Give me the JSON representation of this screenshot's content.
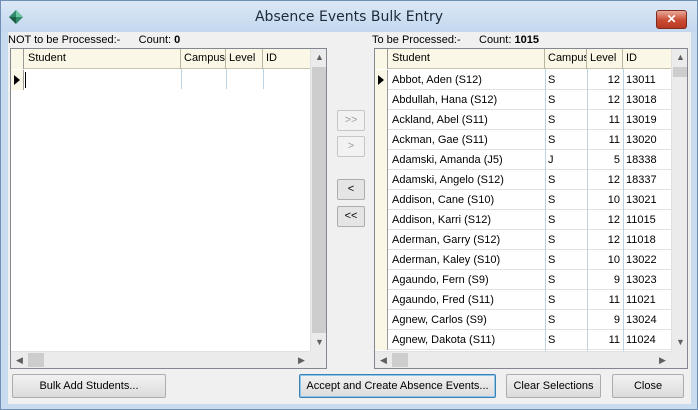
{
  "window": {
    "title": "Absence Events Bulk Entry",
    "close_glyph": "✕"
  },
  "left": {
    "caption_label": "NOT to be Processed:-",
    "count_label": "Count:",
    "count_value": "0",
    "columns": [
      "Student",
      "Campus",
      "Level",
      "ID"
    ]
  },
  "right": {
    "caption_label": "To be Processed:-",
    "count_label": "Count:",
    "count_value": "1015",
    "columns": [
      "Student",
      "Campus",
      "Level",
      "ID"
    ],
    "rows": [
      {
        "student": "Abbot, Aden (S12)",
        "campus": "S",
        "level": "12",
        "id": "13011"
      },
      {
        "student": "Abdullah, Hana (S12)",
        "campus": "S",
        "level": "12",
        "id": "13018"
      },
      {
        "student": "Ackland, Abel (S11)",
        "campus": "S",
        "level": "11",
        "id": "13019"
      },
      {
        "student": "Ackman, Gae (S11)",
        "campus": "S",
        "level": "11",
        "id": "13020"
      },
      {
        "student": "Adamski, Amanda (J5)",
        "campus": "J",
        "level": "5",
        "id": "18338"
      },
      {
        "student": "Adamski, Angelo (S12)",
        "campus": "S",
        "level": "12",
        "id": "18337"
      },
      {
        "student": "Addison, Cane (S10)",
        "campus": "S",
        "level": "10",
        "id": "13021"
      },
      {
        "student": "Addison, Karri (S12)",
        "campus": "S",
        "level": "12",
        "id": "11015"
      },
      {
        "student": "Aderman, Garry (S12)",
        "campus": "S",
        "level": "12",
        "id": "11018"
      },
      {
        "student": "Aderman, Kaley (S10)",
        "campus": "S",
        "level": "10",
        "id": "13022"
      },
      {
        "student": "Agaundo, Fern (S9)",
        "campus": "S",
        "level": "9",
        "id": "13023"
      },
      {
        "student": "Agaundo, Fred (S11)",
        "campus": "S",
        "level": "11",
        "id": "11021"
      },
      {
        "student": "Agnew, Carlos (S9)",
        "campus": "S",
        "level": "9",
        "id": "13024"
      },
      {
        "student": "Agnew, Dakota (S11)",
        "campus": "S",
        "level": "11",
        "id": "11024"
      }
    ]
  },
  "movers": {
    "add_all": ">>",
    "add": ">",
    "remove": "<",
    "remove_all": "<<"
  },
  "buttons": {
    "bulk_add": "Bulk Add Students...",
    "accept": "Accept and Create Absence Events...",
    "clear": "Clear Selections",
    "close": "Close"
  },
  "scroll_glyphs": {
    "up": "▲",
    "down": "▼",
    "left": "◀",
    "right": "▶"
  }
}
